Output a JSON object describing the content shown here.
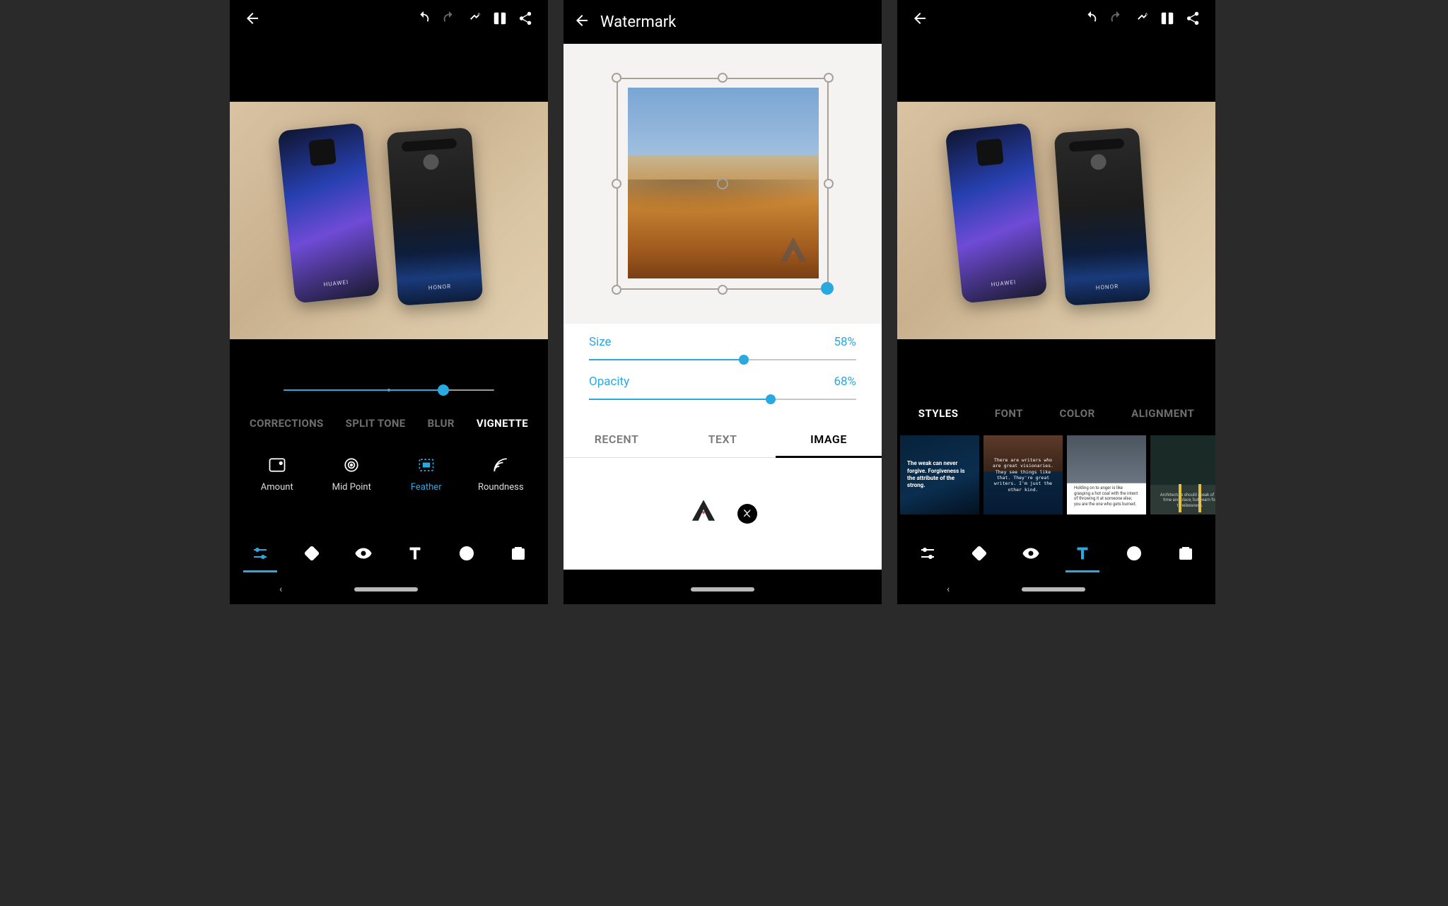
{
  "accent": "#2aa8e0",
  "screen1": {
    "feather_slider": {
      "value_pct": 76
    },
    "adjustment_tabs": [
      {
        "id": "corrections",
        "label": "CORRECTIONS",
        "active": false
      },
      {
        "id": "split-tone",
        "label": "SPLIT TONE",
        "active": false
      },
      {
        "id": "blur",
        "label": "BLUR",
        "active": false
      },
      {
        "id": "vignette",
        "label": "VIGNETTE",
        "active": true
      }
    ],
    "adjustment_options": [
      {
        "id": "amount",
        "label": "Amount",
        "selected": false
      },
      {
        "id": "midpoint",
        "label": "Mid Point",
        "selected": false
      },
      {
        "id": "feather",
        "label": "Feather",
        "selected": true
      },
      {
        "id": "roundness",
        "label": "Roundness",
        "selected": false
      }
    ]
  },
  "screen2": {
    "title": "Watermark",
    "size": {
      "label": "Size",
      "value_text": "58%",
      "value_pct": 58
    },
    "opacity": {
      "label": "Opacity",
      "value_text": "68%",
      "value_pct": 68
    },
    "tabs": [
      {
        "id": "recent",
        "label": "RECENT",
        "active": false
      },
      {
        "id": "text",
        "label": "TEXT",
        "active": false
      },
      {
        "id": "image",
        "label": "IMAGE",
        "active": true
      }
    ]
  },
  "screen3": {
    "style_tabs": [
      {
        "id": "styles",
        "label": "STYLES",
        "active": true
      },
      {
        "id": "font",
        "label": "FONT",
        "active": false
      },
      {
        "id": "color",
        "label": "COLOR",
        "active": false
      },
      {
        "id": "alignment",
        "label": "ALIGNMENT",
        "active": false
      }
    ],
    "cards": [
      {
        "text": "The weak can never forgive. Forgiveness is the attribute of the strong."
      },
      {
        "text": "There are writers who are great visionaries. They see things like that. They're great writers. I'm just the other kind."
      },
      {
        "text": "Holding on to anger is like grasping a hot coal with the intent of throwing it at someone else; you are the one who gets burned."
      },
      {
        "text": "Architecture should speak of its time and place, but yearn for timelessness."
      }
    ]
  },
  "phone_a_brand": "HUAWEI",
  "phone_b_brand": "HONOR"
}
